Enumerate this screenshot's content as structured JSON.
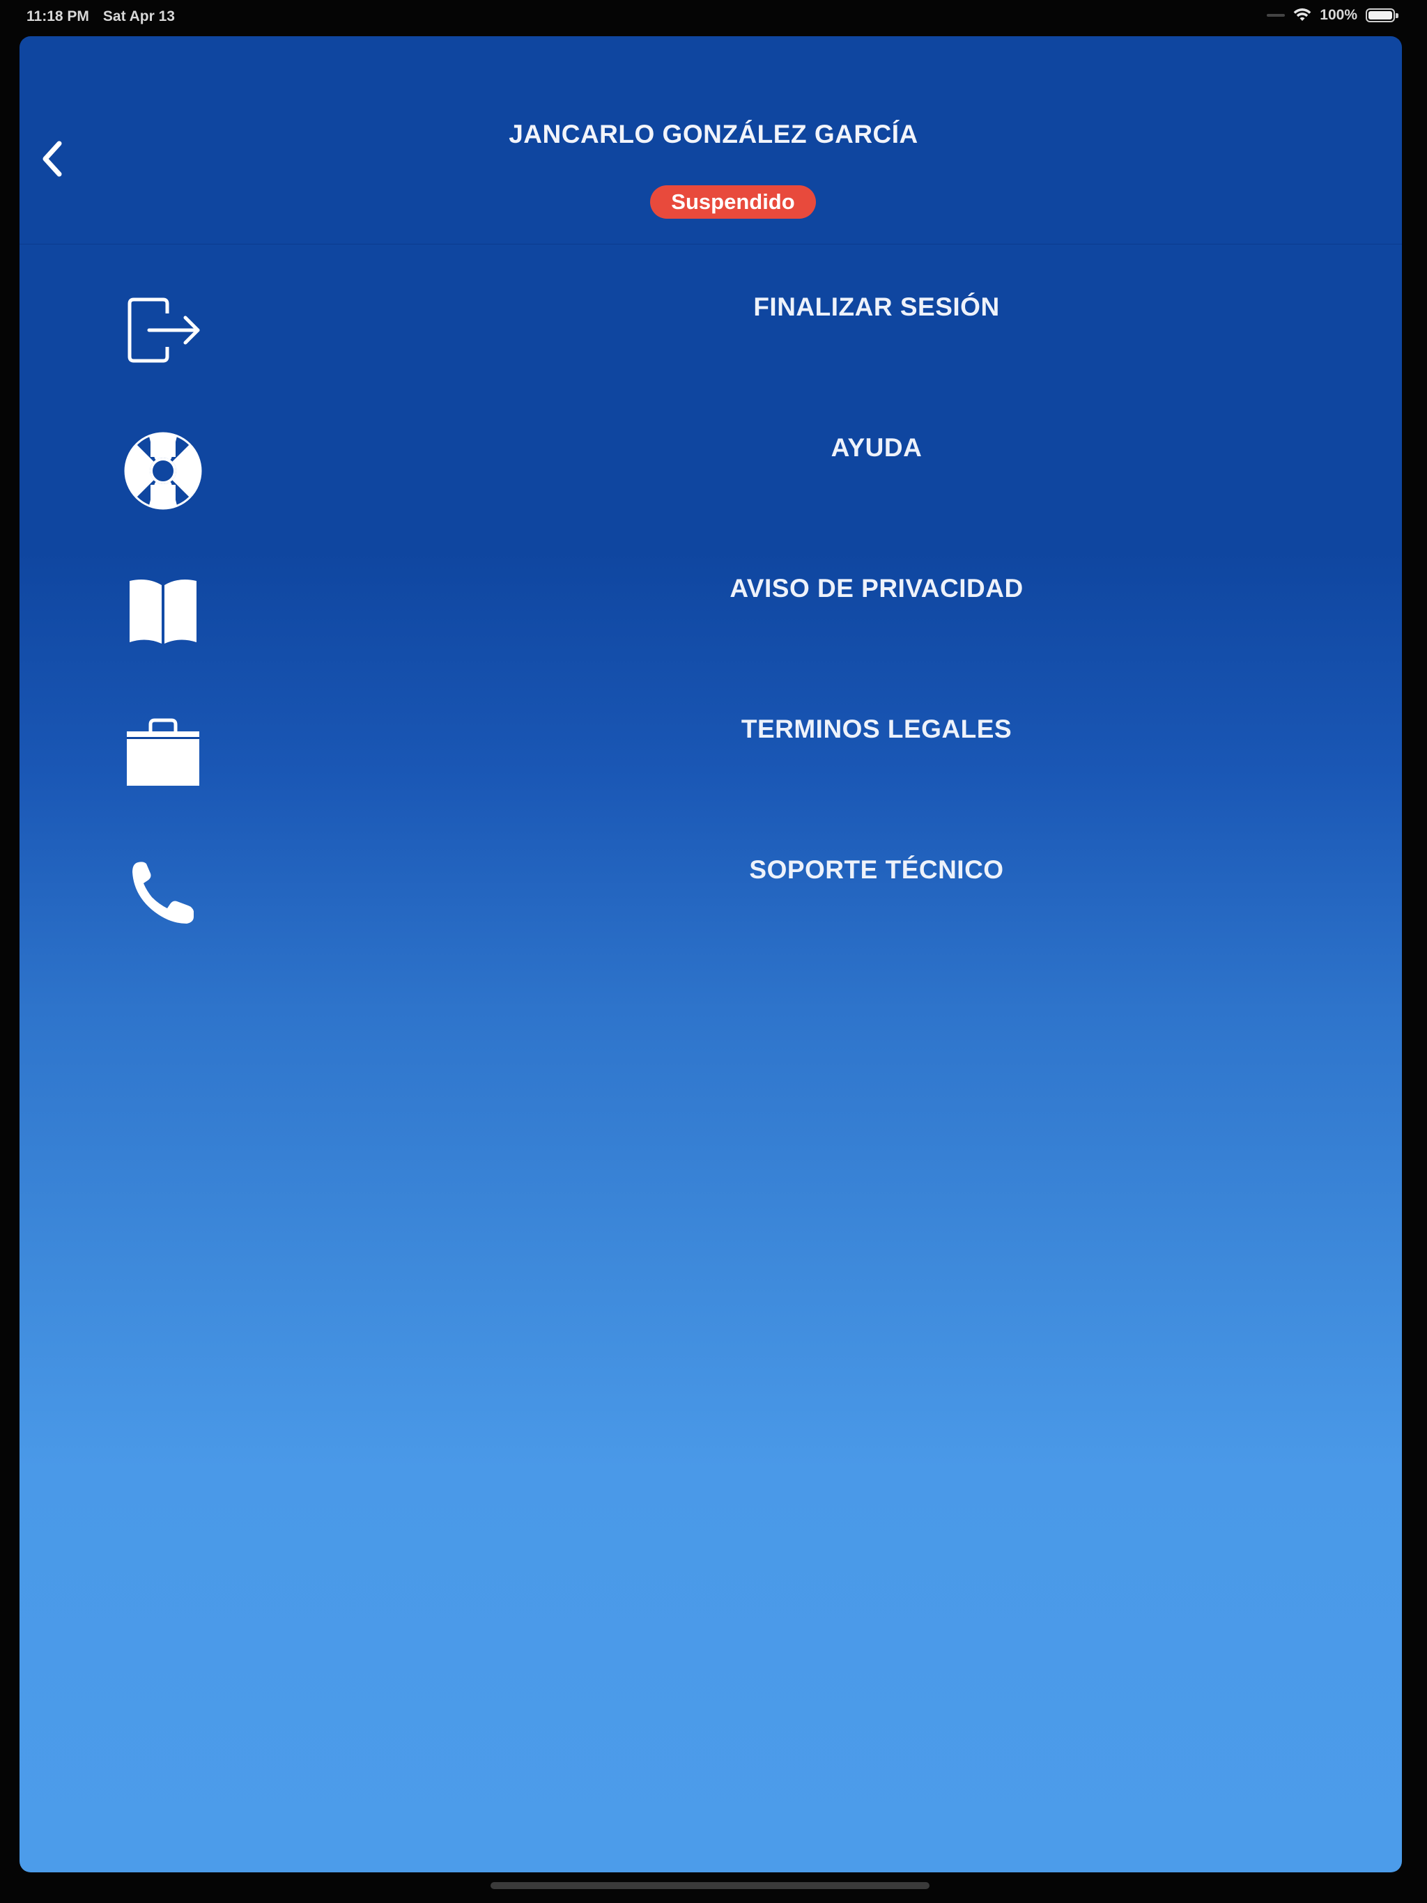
{
  "status_bar": {
    "time": "11:18 PM",
    "date": "Sat Apr 13",
    "battery": "100%",
    "battery_level": 1.0
  },
  "header": {
    "back_icon": "chevron-left-icon",
    "user_name": "JANCARLO GONZÁLEZ GARCÍA",
    "status_badge": "Suspendido",
    "badge_color": "#e84a3c"
  },
  "menu": {
    "items": [
      {
        "label": "FINALIZAR SESIÓN",
        "icon": "logout-icon"
      },
      {
        "label": "AYUDA",
        "icon": "lifebuoy-icon"
      },
      {
        "label": "AVISO DE PRIVACIDAD",
        "icon": "book-icon"
      },
      {
        "label": "TERMINOS LEGALES",
        "icon": "briefcase-icon"
      },
      {
        "label": "SOPORTE TÉCNICO",
        "icon": "phone-icon"
      }
    ]
  },
  "colors": {
    "background_top": "#0f46a0",
    "background_bottom": "#4c9cea",
    "text": "#eef2fa"
  }
}
